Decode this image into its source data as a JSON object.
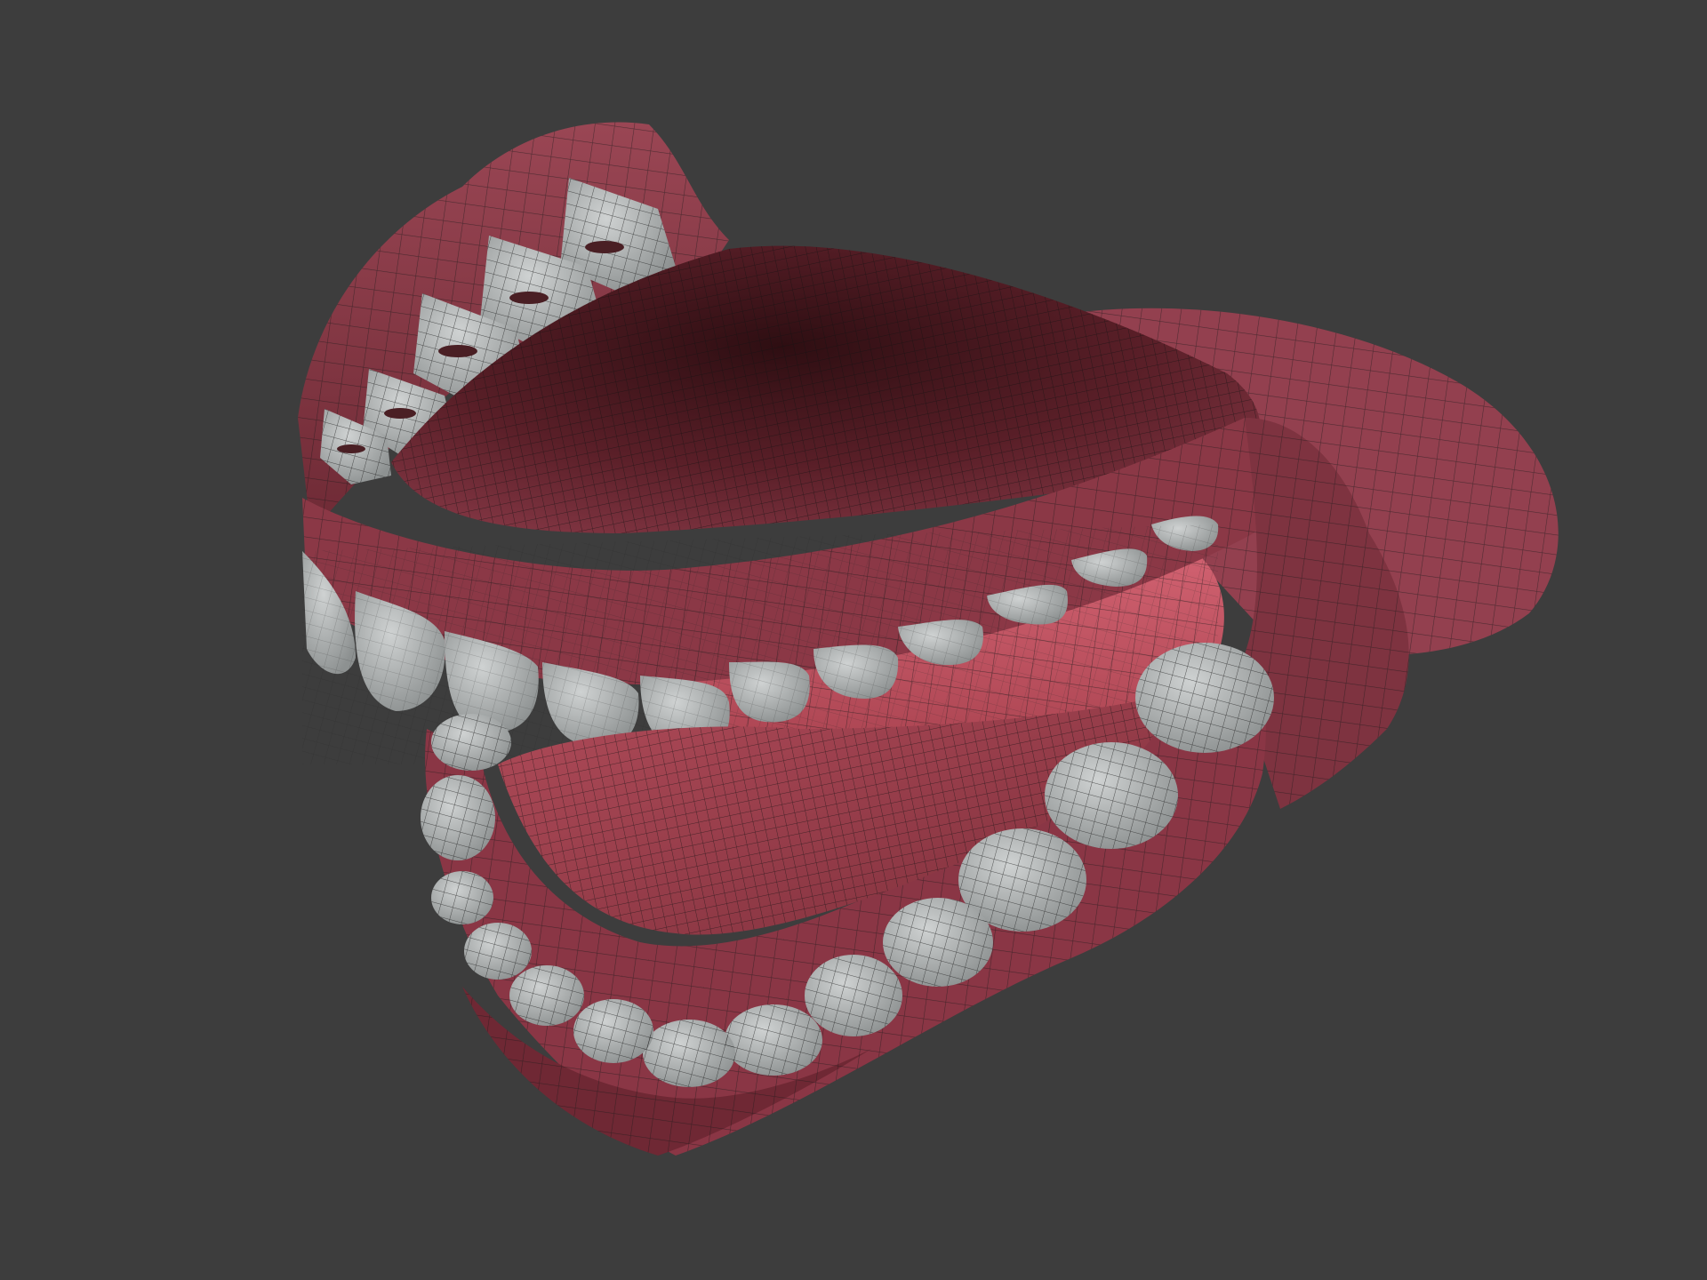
{
  "viewport": {
    "background_color": "#3d3d3d",
    "render_mode": "shaded-wireframe"
  },
  "model": {
    "subject": "dentures-upper-lower-jaw",
    "gum_color": "#8f3f4c",
    "gum_dark_color": "#4a1c22",
    "palate_color": "#5e222b",
    "inner_mouth_color": "#c35866",
    "tooth_color": "#b7bbbb",
    "wire_color": "#1a1a1a"
  }
}
